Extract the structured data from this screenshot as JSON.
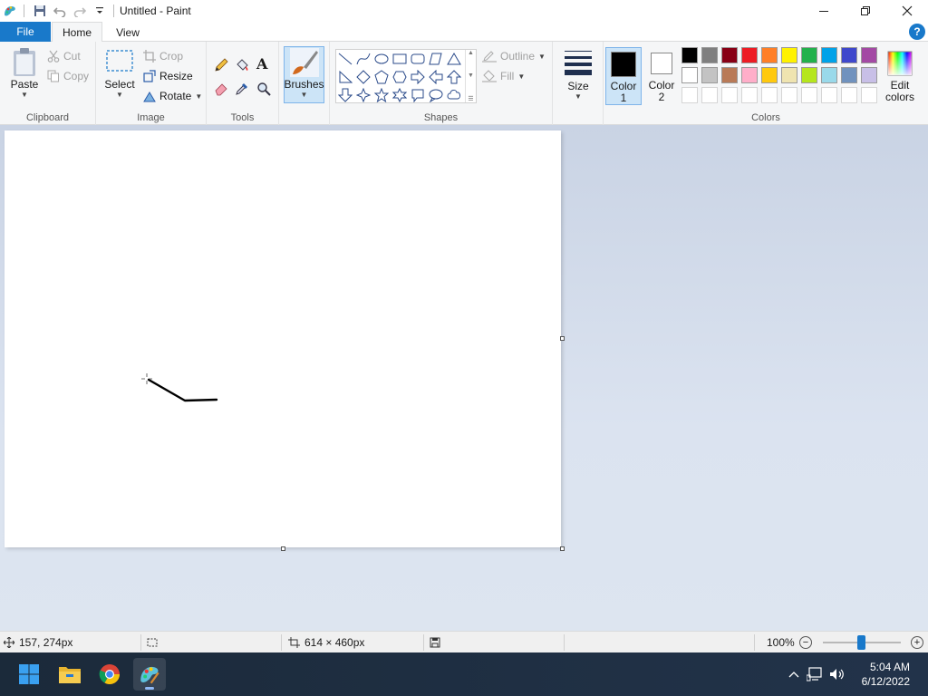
{
  "window": {
    "title": "Untitled - Paint"
  },
  "tabs": {
    "file": "File",
    "home": "Home",
    "view": "View"
  },
  "help": "?",
  "clipboard": {
    "paste": "Paste",
    "cut": "Cut",
    "copy": "Copy",
    "label": "Clipboard"
  },
  "image": {
    "select": "Select",
    "crop": "Crop",
    "resize": "Resize",
    "rotate": "Rotate",
    "label": "Image"
  },
  "tools": {
    "label": "Tools",
    "text_tool": "A"
  },
  "brushes": {
    "label": "Brushes"
  },
  "shapes": {
    "label": "Shapes",
    "outline": "Outline",
    "fill": "Fill"
  },
  "size": {
    "label": "Size"
  },
  "colors": {
    "label": "Colors",
    "color1_line1": "Color",
    "color1_line2": "1",
    "color2_line1": "Color",
    "color2_line2": "2",
    "edit_line1": "Edit",
    "edit_line2": "colors",
    "color1_value": "#000000",
    "color2_value": "#ffffff",
    "row1": [
      "#000000",
      "#7f7f7f",
      "#880015",
      "#ed1c24",
      "#ff7f27",
      "#fff200",
      "#22b14c",
      "#00a2e8",
      "#3f48cc",
      "#a349a4"
    ],
    "row2": [
      "#ffffff",
      "#c3c3c3",
      "#b97a57",
      "#ffaec9",
      "#ffc90e",
      "#efe4b0",
      "#b5e61d",
      "#99d9ea",
      "#7092be",
      "#c8bfe7"
    ]
  },
  "status": {
    "cursor_pos": "157, 274px",
    "canvas_size": "614 × 460px",
    "zoom": "100%",
    "zoom_minus": "−",
    "zoom_plus": "+"
  },
  "taskbar": {
    "time": "5:04 AM",
    "date": "6/12/2022"
  }
}
